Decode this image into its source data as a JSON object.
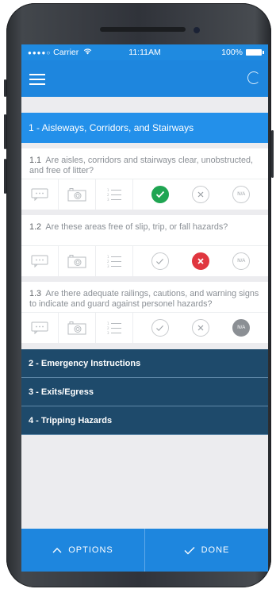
{
  "status": {
    "carrier": "Carrier",
    "time": "11:11AM",
    "battery": "100%"
  },
  "sections": [
    {
      "title": "1 - Aisleways, Corridors, and Stairways"
    },
    {
      "title": "2 - Emergency Instructions"
    },
    {
      "title": "3 - Exits/Egress"
    },
    {
      "title": "4 - Tripping Hazards"
    }
  ],
  "questions": [
    {
      "num": "1.1",
      "text": "Are aisles, corridors and stairways clear, unobstructed, and free of litter?",
      "answer": "yes"
    },
    {
      "num": "1.2",
      "text": "Are these areas free of slip, trip, or fall hazards?",
      "answer": "no"
    },
    {
      "num": "1.3",
      "text": "Are there adequate railings, cautions, and warning signs to indicate and guard against personel hazards?",
      "answer": "na"
    }
  ],
  "choice_labels": {
    "na": "N/A"
  },
  "bottom": {
    "options": "OPTIONS",
    "done": "DONE"
  },
  "colors": {
    "primary": "#1e86de",
    "section_active": "#2390ea",
    "section_dark": "#1e4a6b",
    "yes": "#1fa552",
    "no": "#e0363f",
    "na": "#8b8f94"
  }
}
